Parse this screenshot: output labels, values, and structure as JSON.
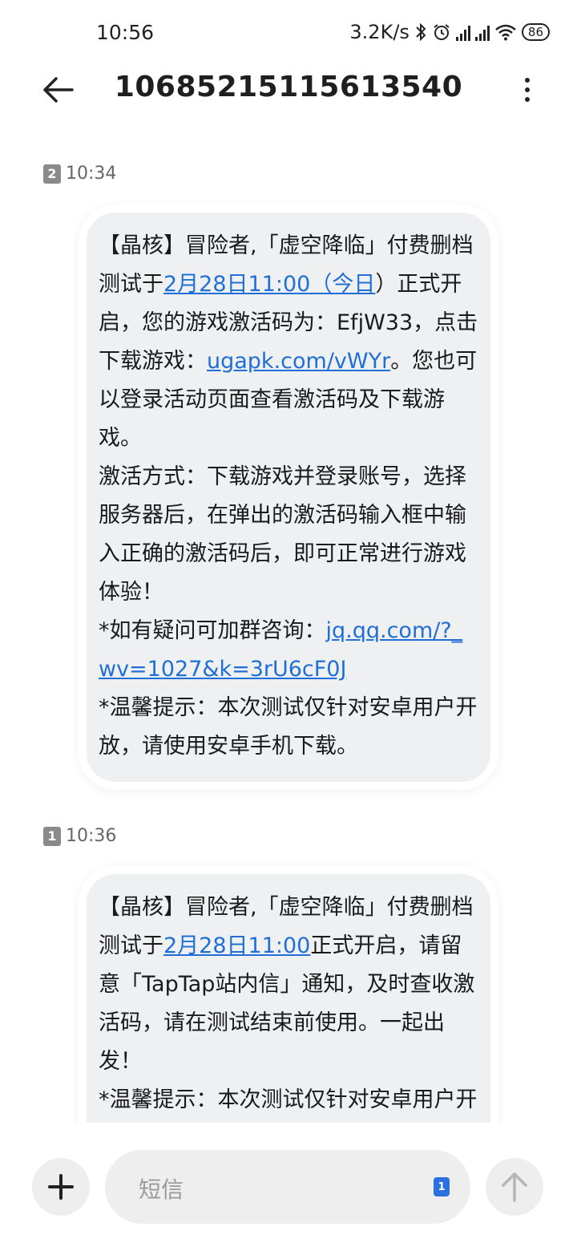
{
  "status_bar": {
    "time": "10:56",
    "net_speed": "3.2K/s",
    "battery": "86",
    "icons": [
      "bluetooth-icon",
      "alarm-icon",
      "signal-icon",
      "signal-icon",
      "wifi-icon",
      "battery-icon"
    ]
  },
  "header": {
    "title": "1068521511561354​0"
  },
  "messages": [
    {
      "sim": "2",
      "time": "10:34",
      "segments": [
        {
          "t": "【晶核】冒险者,「虚空降临」付费删档测试于"
        },
        {
          "t": "2月28日11:00（今日",
          "link": true
        },
        {
          "t": "）正式开启，您的游戏激活码为：EfjW33，点击下载游戏："
        },
        {
          "t": "ugapk.com/vWYr",
          "link": true
        },
        {
          "t": "。您也可以登录活动页面查看激活码及下载游戏。"
        },
        {
          "t": "\n激活方式：下载游戏并登录账号，选择服务器后，在弹出的激活码输入框中输入正确的激活码后，即可正常进行游戏体验！"
        },
        {
          "t": "\n*如有疑问可加群咨询："
        },
        {
          "t": "jq.qq.com/?_wv=1027&k=3rU6cF0J",
          "link": true
        },
        {
          "t": "\n*温馨提示：本次测试仅针对安卓用户开放，请使用安卓手机下载。"
        }
      ]
    },
    {
      "sim": "1",
      "time": "10:36",
      "segments": [
        {
          "t": "【晶核】冒险者,「虚空降临」付费删档测试于"
        },
        {
          "t": "2月28日11:00",
          "link": true
        },
        {
          "t": "正式开启，请留意「TapTap站内信」通知，及时查收激活码，请在测试结束前使用。一起出发！"
        },
        {
          "t": "\n*温馨提示：本次测试仅针对安卓用户开放，请使用安卓手机下载。"
        }
      ]
    }
  ],
  "composer": {
    "placeholder": "短信",
    "sim_selected": "1"
  },
  "colors": {
    "link": "#1f6fd6",
    "bubble": "#eff0f2",
    "sim_pick": "#2b6fe0"
  }
}
